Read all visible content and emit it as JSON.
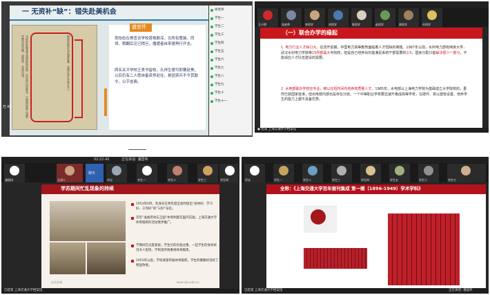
{
  "panel1": {
    "title": "一 无资补“缺”：错失赴美机会",
    "sidebar_title": "盛宣怀",
    "doc_paragraph1": "当恰恰赴美游学须得款项资助，实非财力所能及，只得将船面上旅费学费均须自备，遂放弃，非常可惜。",
    "doc_paragraph2": "国官资助实为先遣赴美，这两位学生在学业上",
    "stamp_para1": "吴怡检在美查访学校甚慨颇深，见所有整装、同领、稍翻后见已稍旦，撞遭者自来便再行开支。",
    "stamp_para2": "两名关平学校王衷书留校，孔祥生便可即要赴美，以后仍有二人愿自备资斧赴往，是因资兵不令其勤令，以节省费。",
    "status": "已 K5",
    "roster": [
      "徐老师",
      "学生一",
      "学生二",
      "学生三",
      "学生四",
      "学生五",
      "学生六",
      "学生七",
      "学生八",
      "学生九",
      "学生十",
      "学生十一"
    ]
  },
  "panel2": {
    "title": "（一）联合办学的缘起",
    "p1_num": "1.",
    "p1_head": "电力行业人才缺口大。",
    "p1_text_a": "在改开前期，中国电力高等教育面临着人才短缺的难题。1987年以前，水利电力部有两家大学，武汉水利电力学院等",
    "p1_hl_1": "15所部属大",
    "p1_text_b": "专院校，但是自己培养出仅能满足系统干部需要的",
    "p1_hl_2": "1/3",
    "p1_text_c": "，国家分配只能",
    "p1_hl_3": "解决很少一部分",
    "p1_text_d": "，不能适应人才队伍建设的需要。",
    "p2_num": "2.",
    "p2_head": "水电部联办学校应专业，难以在短时间内培养高质量人才。",
    "p2_text": "1985年，水电部以上海电力学院为基础成立大学院校的，虽然已获国家批准，但出电部内部也是存在分歧，一个中等职业学校要迅速升格成高等学校，在硬件、意以建管设置、培养学生的能力上都不具备优势。",
    "footer": "● 结束 上海交通大学档案馆",
    "names": [
      "王小明",
      "张老师",
      "李同学",
      "刘同学",
      "陈同学",
      "赵同学",
      "周同学",
      "孙同学"
    ]
  },
  "panel3": {
    "topbar_text": "正在讲话: 潘国伟",
    "time": "02:22:40",
    "slide_title": "学苏期间忙乱现象的持续",
    "b1": "1953年6月，毛泽东在青年团全会时提出“身体好、学习好、工作好”的“三好”号召。",
    "b2": "次年“准备劳动与卫国”体育制度在国内实施，上海交通大学体育锻炼的活动逐步推广。",
    "b3": "学期间在过度紧张，学生们的负担过重，一些学生的身体状况令人担忧，学校遂开始重视体育锻炼。",
    "b4": "1955年以后，学校逐渐开展体育锻炼，学生的健康状况有了明显改善。",
    "footer_left": "交大在线",
    "footer_right": "www.sjtu.edu.cn",
    "names": [
      "潘国伟",
      "主讲人",
      "聊天",
      "评论",
      "学生一",
      "学生二",
      "学生三",
      "学生四"
    ],
    "bottom_text": "已结束 上海交通大学档案馆"
  },
  "panel4": {
    "title": "全称：《上海交通大学百年报刊集成 第一辑（1896-1949）学术学科》",
    "names": [
      "评论",
      "学生一",
      "学生二",
      "学生三",
      "学生四",
      "学生五",
      "学生六",
      "学生七"
    ],
    "bottom_text": "已结束 上海交通大学档案馆",
    "bottom_right": "正在讲话: 潘国伟"
  }
}
